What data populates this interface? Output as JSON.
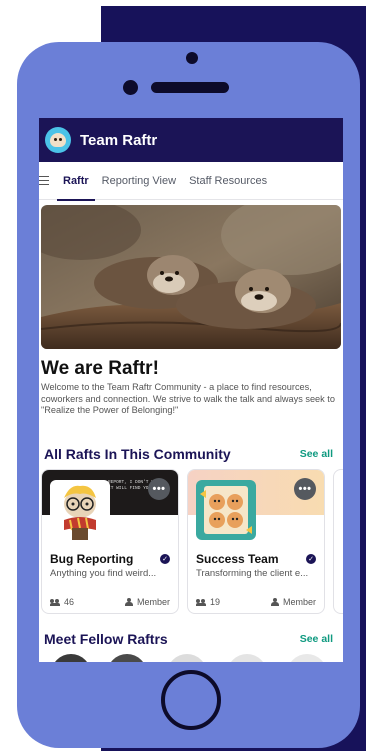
{
  "app": {
    "title": "Team Raftr"
  },
  "tabs": [
    {
      "label": "Raftr",
      "active": true
    },
    {
      "label": "Reporting View",
      "active": false
    },
    {
      "label": "Staff Resources",
      "active": false
    }
  ],
  "hero": {
    "title": "We are Raftr!",
    "description": "Welcome to the Team Raftr Community - a place to find resources, coworkers and connection. We strive to walk the talk and always seek to \"Realize the Power of Belonging!\""
  },
  "rafts_section": {
    "title": "All Rafts In This Community",
    "see_all": "See all"
  },
  "rafts": [
    {
      "name": "Bug Reporting",
      "description": "Anything you find weird...",
      "members": "46",
      "role": "Member",
      "banner_text": "REPORT, I DON'T KNOW\nIT WILL FIND YOU AND"
    },
    {
      "name": "Success Team",
      "description": "Transforming the client e...",
      "members": "19",
      "role": "Member"
    }
  ],
  "people_section": {
    "title": "Meet Fellow Raftrs",
    "see_all": "See all"
  },
  "colors": {
    "brand_dark": "#1b1456",
    "phone": "#6b7fd7",
    "accent_link": "#0f9a80"
  },
  "icons": [
    "menu-icon",
    "more-icon",
    "verified-icon",
    "people-icon",
    "person-icon"
  ]
}
